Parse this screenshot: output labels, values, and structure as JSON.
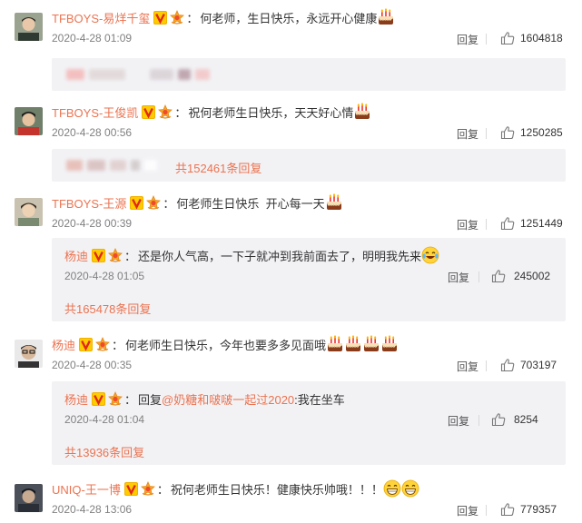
{
  "comments": [
    {
      "user": "TFBOYS-易烊千玺",
      "text": "何老师，生日快乐，永远开心健康",
      "date": "2020-4-28 01:09",
      "reply_label": "回复",
      "likes": "1604818"
    },
    {
      "user": "TFBOYS-王俊凯",
      "text": "祝何老师生日快乐，天天好心情",
      "date": "2020-4-28 00:56",
      "reply_label": "回复",
      "likes": "1250285",
      "total_replies": "共152461条回复"
    },
    {
      "user": "TFBOYS-王源",
      "text": "何老师生日快乐  开心每一天",
      "date": "2020-4-28 00:39",
      "reply_label": "回复",
      "likes": "1251449",
      "sub": {
        "user": "杨迪",
        "text": "还是你人气高，一下子就冲到我前面去了，明明我先来",
        "date": "2020-4-28 01:05",
        "reply_label": "回复",
        "likes": "245002"
      },
      "total_replies": "共165478条回复"
    },
    {
      "user": "杨迪",
      "text": "何老师生日快乐，今年也要多多见面哦",
      "date": "2020-4-28 00:35",
      "reply_label": "回复",
      "likes": "703197",
      "sub": {
        "user": "杨迪",
        "reply_prefix": "回复",
        "mention": "@奶糖和啵啵一起过2020",
        "text": ":我在坐车",
        "date": "2020-4-28 01:04",
        "reply_label": "回复",
        "likes": "8254"
      },
      "total_replies": "共13936条回复"
    },
    {
      "user": "UNIQ-王一博",
      "text": "祝何老师生日快乐！健康快乐帅哦！！！",
      "date": "2020-4-28 13:06",
      "reply_label": "回复",
      "likes": "779357"
    }
  ],
  "colon": "：",
  "colors": {
    "username": "#eb7350",
    "subbox": "#f2f2f5",
    "meta": "#808080"
  },
  "icons": [
    "verified-v-icon",
    "star-badge-icon",
    "cake-emoji-icon",
    "laugh-cry-emoji-icon",
    "grin-emoji-icon",
    "thumbs-up-icon"
  ]
}
